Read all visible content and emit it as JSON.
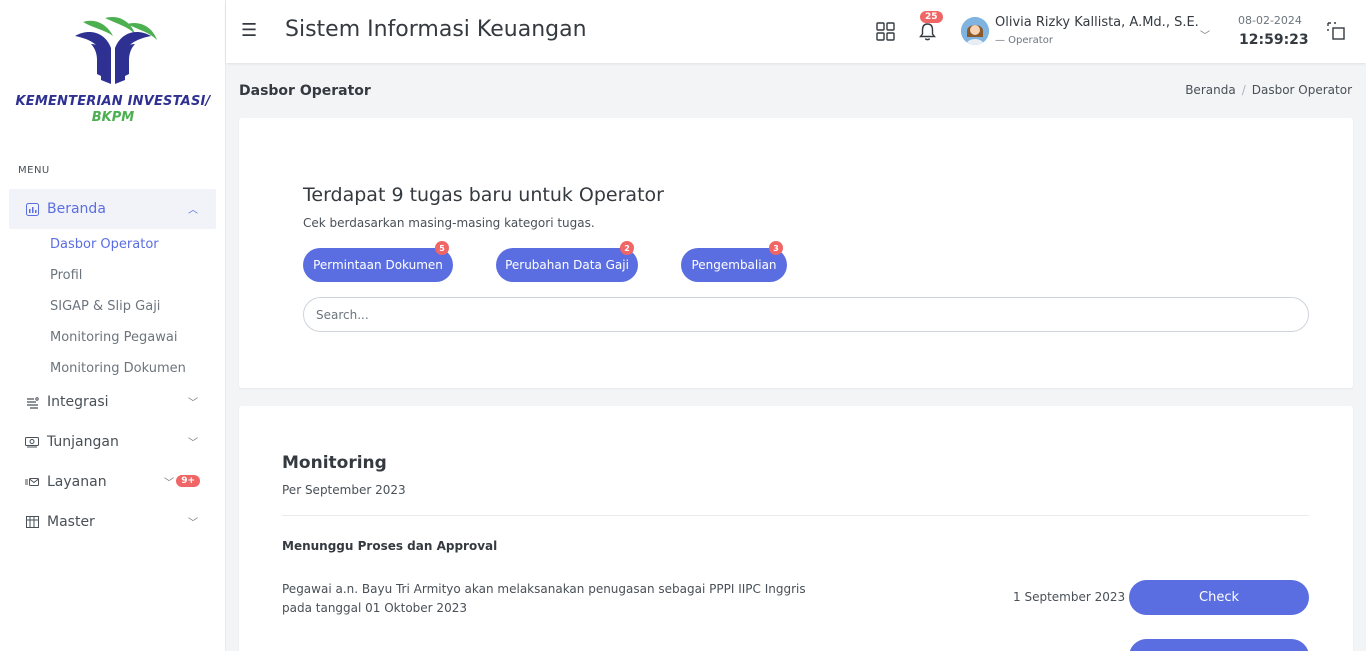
{
  "brand": {
    "line1": "KEMENTERIAN INVESTASI/",
    "line2": "BKPM"
  },
  "sidebar": {
    "menu_title": "MENU",
    "items": [
      {
        "label": "Beranda",
        "icon": "chart-icon"
      },
      {
        "label": "Integrasi",
        "icon": "integration-icon"
      },
      {
        "label": "Tunjangan",
        "icon": "money-icon"
      },
      {
        "label": "Layanan",
        "icon": "service-icon",
        "badge": "9+"
      },
      {
        "label": "Master",
        "icon": "database-icon"
      }
    ],
    "subitems": [
      {
        "label": "Dasbor Operator"
      },
      {
        "label": "Profil"
      },
      {
        "label": "SIGAP & Slip Gaji"
      },
      {
        "label": "Monitoring Pegawai"
      },
      {
        "label": "Monitoring Dokumen"
      }
    ]
  },
  "header": {
    "app_title": "Sistem Informasi Keuangan",
    "notification_count": "25",
    "user_name": "Olivia Rizky Kallista, A.Md., S.E.",
    "user_role": "— Operator",
    "date": "08-02-2024",
    "time": "12:59:23"
  },
  "page": {
    "title": "Dasbor Operator",
    "breadcrumb": [
      "Beranda",
      "Dasbor Operator"
    ]
  },
  "tasks": {
    "title": "Terdapat 9 tugas baru untuk Operator",
    "subtitle": "Cek berdasarkan masing-masing kategori tugas.",
    "categories": [
      {
        "label": "Permintaan Dokumen",
        "count": "5"
      },
      {
        "label": "Perubahan Data Gaji",
        "count": "2"
      },
      {
        "label": "Pengembalian",
        "count": "3"
      }
    ],
    "search_placeholder": "Search..."
  },
  "monitoring": {
    "title": "Monitoring",
    "subtitle": "Per September 2023",
    "section": "Menunggu Proses dan Approval",
    "rows": [
      {
        "text": "Pegawai a.n. Bayu Tri Armityo akan melaksanakan penugasan sebagai PPPI IIPC Inggris pada tanggal 01 Oktober 2023",
        "date": "1 September 2023",
        "action": "Check"
      }
    ]
  },
  "colors": {
    "accent": "#5b6ee1",
    "badge": "#f06565",
    "brand_blue": "#2e3192",
    "brand_green": "#4caf50"
  }
}
